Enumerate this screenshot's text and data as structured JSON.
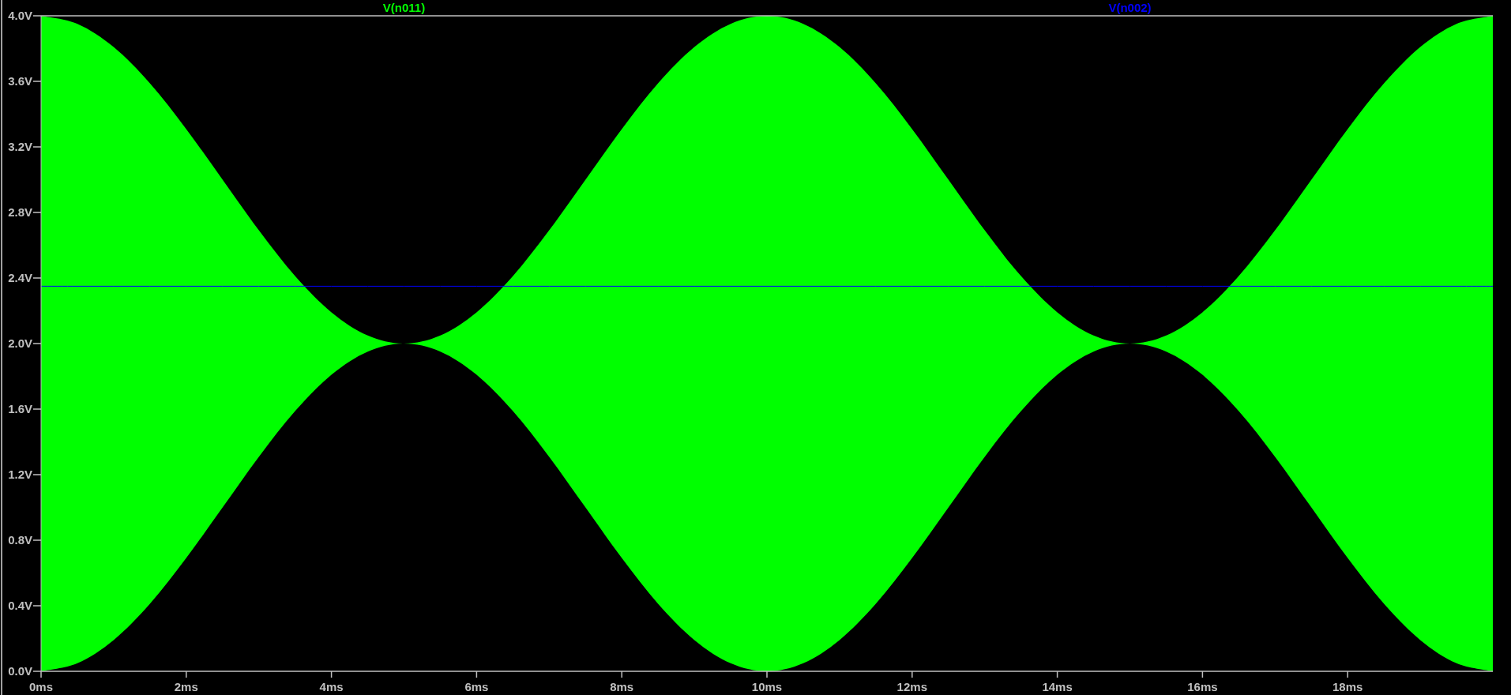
{
  "chart_data": {
    "type": "line",
    "xlim": [
      0,
      20
    ],
    "ylim": [
      0,
      4
    ],
    "xticks": [
      {
        "value": 0,
        "label": "0ms"
      },
      {
        "value": 2,
        "label": "2ms"
      },
      {
        "value": 4,
        "label": "4ms"
      },
      {
        "value": 6,
        "label": "6ms"
      },
      {
        "value": 8,
        "label": "8ms"
      },
      {
        "value": 10,
        "label": "10ms"
      },
      {
        "value": 12,
        "label": "12ms"
      },
      {
        "value": 14,
        "label": "14ms"
      },
      {
        "value": 16,
        "label": "16ms"
      },
      {
        "value": 18,
        "label": "18ms"
      }
    ],
    "yticks": [
      {
        "value": 0,
        "label": "0.0V"
      },
      {
        "value": 0.4,
        "label": "0.4V"
      },
      {
        "value": 0.8,
        "label": "0.8V"
      },
      {
        "value": 1.2,
        "label": "1.2V"
      },
      {
        "value": 1.6,
        "label": "1.6V"
      },
      {
        "value": 2,
        "label": "2.0V"
      },
      {
        "value": 2.4,
        "label": "2.4V"
      },
      {
        "value": 2.8,
        "label": "2.8V"
      },
      {
        "value": 3.2,
        "label": "3.2V"
      },
      {
        "value": 3.6,
        "label": "3.6V"
      },
      {
        "value": 4,
        "label": "4.0V"
      }
    ],
    "x": [
      0,
      0.5,
      1,
      1.5,
      2,
      2.5,
      3,
      3.5,
      4,
      4.5,
      5,
      5.5,
      6,
      6.5,
      7,
      7.5,
      8,
      8.5,
      9,
      9.5,
      10,
      10.5,
      11,
      11.5,
      12,
      12.5,
      13,
      13.5,
      14,
      14.5,
      15,
      15.5,
      16,
      16.5,
      17,
      17.5,
      18,
      18.5,
      19,
      19.5,
      20
    ],
    "series": [
      {
        "name": "V(n011)",
        "type": "area",
        "color": "#00ff00",
        "values": [
          4,
          3.951,
          3.809,
          3.588,
          3.309,
          3,
          2.691,
          2.412,
          2.191,
          2.049,
          2,
          2.049,
          2.191,
          2.412,
          2.691,
          3,
          3.309,
          3.588,
          3.809,
          3.951,
          4,
          3.951,
          3.809,
          3.588,
          3.309,
          3,
          2.691,
          2.412,
          2.191,
          2.049,
          2,
          2.049,
          2.191,
          2.412,
          2.691,
          3,
          3.309,
          3.588,
          3.809,
          3.951,
          4
        ]
      },
      {
        "name": "V(n002)",
        "type": "line",
        "color": "#0000ff",
        "values": [
          2.35,
          2.35,
          2.35,
          2.35,
          2.35,
          2.35,
          2.35,
          2.35,
          2.35,
          2.35,
          2.35,
          2.35,
          2.35,
          2.35,
          2.35,
          2.35,
          2.35,
          2.35,
          2.35,
          2.35,
          2.35,
          2.35,
          2.35,
          2.35,
          2.35,
          2.35,
          2.35,
          2.35,
          2.35,
          2.35,
          2.35,
          2.35,
          2.35,
          2.35,
          2.35,
          2.35,
          2.35,
          2.35,
          2.35,
          2.35,
          2.35
        ]
      }
    ]
  }
}
